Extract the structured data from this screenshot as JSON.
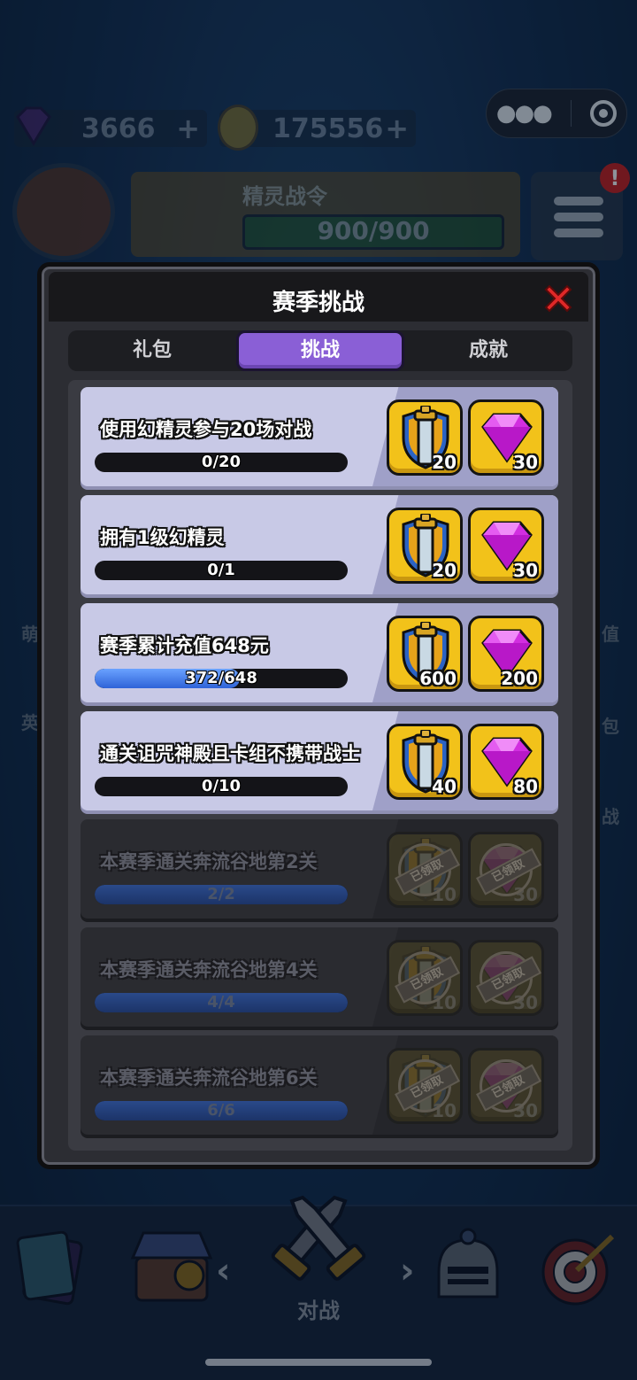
{
  "topbar": {
    "gems": "3666",
    "coins": "175556",
    "plus_symbol": "+",
    "capsule_menu_icon": "more-dots-icon",
    "capsule_target_icon": "target-icon"
  },
  "battle_pass": {
    "title": "精灵战令",
    "progress_text": "900/900",
    "menu_badge": "!"
  },
  "side_labels_left": [
    "萌",
    "英"
  ],
  "side_labels_right": [
    "值",
    "包",
    "战"
  ],
  "modal": {
    "title": "赛季挑战",
    "close_icon": "close-x-icon",
    "tabs": [
      {
        "label": "礼包",
        "active": false
      },
      {
        "label": "挑战",
        "active": true
      },
      {
        "label": "成就",
        "active": false
      }
    ],
    "challenges": [
      {
        "title": "使用幻精灵参与20场对战",
        "progress": "0/20",
        "fraction": 0,
        "rewards": [
          {
            "icon": "sword-shield-icon",
            "qty": "20"
          },
          {
            "icon": "gem-icon",
            "qty": "30"
          }
        ],
        "claimed": false
      },
      {
        "title": "拥有1级幻精灵",
        "progress": "0/1",
        "fraction": 0,
        "rewards": [
          {
            "icon": "sword-shield-icon",
            "qty": "20"
          },
          {
            "icon": "gem-icon",
            "qty": "30"
          }
        ],
        "claimed": false
      },
      {
        "title": "赛季累计充值648元",
        "progress": "372/648",
        "fraction": 0.574,
        "rewards": [
          {
            "icon": "sword-shield-icon",
            "qty": "600"
          },
          {
            "icon": "gem-icon",
            "qty": "200"
          }
        ],
        "claimed": false
      },
      {
        "title": "通关诅咒神殿且卡组不携带战士",
        "progress": "0/10",
        "fraction": 0,
        "rewards": [
          {
            "icon": "sword-shield-icon",
            "qty": "40"
          },
          {
            "icon": "gem-icon",
            "qty": "80"
          }
        ],
        "claimed": false
      },
      {
        "title": "本赛季通关奔流谷地第2关",
        "progress": "2/2",
        "fraction": 1,
        "rewards": [
          {
            "icon": "sword-shield-icon",
            "qty": "10"
          },
          {
            "icon": "gem-icon",
            "qty": "30"
          }
        ],
        "claimed": true
      },
      {
        "title": "本赛季通关奔流谷地第4关",
        "progress": "4/4",
        "fraction": 1,
        "rewards": [
          {
            "icon": "sword-shield-icon",
            "qty": "10"
          },
          {
            "icon": "gem-icon",
            "qty": "30"
          }
        ],
        "claimed": true
      },
      {
        "title": "本赛季通关奔流谷地第6关",
        "progress": "6/6",
        "fraction": 1,
        "rewards": [
          {
            "icon": "sword-shield-icon",
            "qty": "10"
          },
          {
            "icon": "gem-icon",
            "qty": "30"
          }
        ],
        "claimed": true
      }
    ],
    "claimed_stamp": "已领取"
  },
  "bottom_nav": {
    "active_label": "对战",
    "left_arrow": "‹",
    "right_arrow": "›",
    "items": [
      "cards-icon",
      "shop-icon",
      "battle-icon",
      "knight-helmet-icon",
      "target-arrow-icon"
    ]
  },
  "colors": {
    "accent_purple": "#8a5fd6",
    "reward_gold": "#f2c21a",
    "progress_blue": "#2f63d8",
    "close_red": "#e02828"
  }
}
